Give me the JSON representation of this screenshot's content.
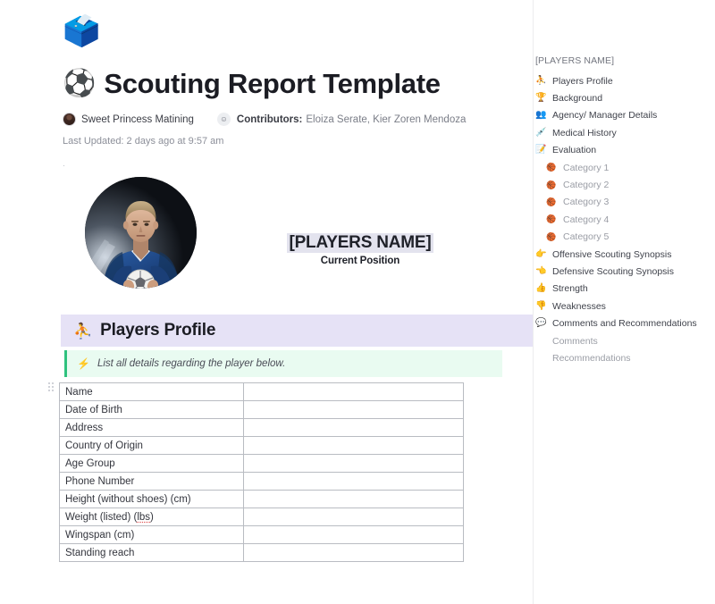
{
  "document": {
    "icon": "ballot-box-emoji",
    "icon_glyph": "🗳️",
    "title_emoji": "⚽",
    "title": "Scouting Report Template",
    "author": "Sweet Princess Matining",
    "contributors_label": "Contributors:",
    "contributors": "Eloiza Serate, Kier Zoren Mendoza",
    "last_updated": "Last Updated: 2 days ago at 9:57 am",
    "stray_mark": "·"
  },
  "hero": {
    "photo_alt": "player-photo",
    "player_name": "[PLAYERS NAME]",
    "current_position": "Current Position",
    "highlight_color": "#e3e3ee"
  },
  "section": {
    "emoji": "⛹️",
    "title": "Players Profile",
    "banner_color": "#e6e2f6",
    "callout_emoji": "⚡",
    "callout_text": "List all details regarding the player below.",
    "callout_bg": "#e9fbf1",
    "callout_bar": "#2ec27e"
  },
  "profile_table": {
    "rows": [
      {
        "label": "Name",
        "value": ""
      },
      {
        "label": "Date of Birth",
        "value": ""
      },
      {
        "label": "Address",
        "value": ""
      },
      {
        "label": "Country of Origin",
        "value": ""
      },
      {
        "label": "Age Group",
        "value": ""
      },
      {
        "label": "Phone Number",
        "value": ""
      },
      {
        "label": "Height (without shoes) (cm)",
        "value": ""
      },
      {
        "label": "Weight (listed) (lbs)",
        "value": ""
      },
      {
        "label": "Wingspan (cm)",
        "value": ""
      },
      {
        "label": "Standing reach",
        "value": ""
      }
    ]
  },
  "sidebar": {
    "heading": "[PLAYERS NAME]",
    "items": [
      {
        "label": "Players Profile",
        "emoji": "⛹️",
        "icon": "player-icon",
        "level": 1
      },
      {
        "label": "Background",
        "emoji": "🏆",
        "icon": "trophy-icon",
        "level": 1
      },
      {
        "label": "Agency/ Manager Details",
        "emoji": "👥",
        "icon": "busts-icon",
        "level": 1
      },
      {
        "label": "Medical History",
        "emoji": "💉",
        "icon": "syringe-icon",
        "level": 1
      },
      {
        "label": "Evaluation",
        "emoji": "📝",
        "icon": "memo-icon",
        "level": 1
      },
      {
        "label": "Category 1",
        "emoji": "🏀",
        "icon": "basketball-icon",
        "level": 2
      },
      {
        "label": "Category 2",
        "emoji": "🏀",
        "icon": "basketball-icon",
        "level": 2
      },
      {
        "label": "Category 3",
        "emoji": "🏀",
        "icon": "basketball-icon",
        "level": 2
      },
      {
        "label": "Category 4",
        "emoji": "🏀",
        "icon": "basketball-icon",
        "level": 2
      },
      {
        "label": "Category 5",
        "emoji": "🏀",
        "icon": "basketball-icon",
        "level": 2
      },
      {
        "label": "Offensive Scouting Synopsis",
        "emoji": "👉",
        "icon": "point-right-icon",
        "level": 1
      },
      {
        "label": "Defensive Scouting Synopsis",
        "emoji": "👈",
        "icon": "point-left-icon",
        "level": 1
      },
      {
        "label": "Strength",
        "emoji": "👍",
        "icon": "thumbs-up-icon",
        "level": 1
      },
      {
        "label": "Weaknesses",
        "emoji": "👎",
        "icon": "thumbs-down-icon",
        "level": 1
      },
      {
        "label": "Comments and Recommendations",
        "emoji": "💬",
        "icon": "comment-icon",
        "level": 1
      },
      {
        "label": "Comments",
        "emoji": "",
        "icon": "",
        "level": 3
      },
      {
        "label": "Recommendations",
        "emoji": "",
        "icon": "",
        "level": 3
      }
    ]
  }
}
